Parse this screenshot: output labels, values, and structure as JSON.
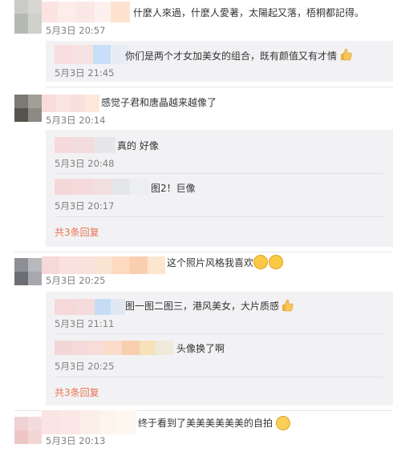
{
  "comments": [
    {
      "text": "什麼人來過，什麼人愛著，太陽起又落，梧桐都記得。",
      "time": "5月3日 20:57",
      "replies": [
        {
          "text": "你们是两个才女加美女的组合，既有颜值又有才情",
          "time": "5月3日 21:45",
          "icon": "thumbs-up-icon"
        }
      ]
    },
    {
      "text": "感觉子君和唐晶越来越像了",
      "time": "5月3日 20:14",
      "replies": [
        {
          "text": "真的 好像",
          "time": "5月3日 20:48"
        },
        {
          "text": "图2！巨像",
          "time": "5月3日 20:17"
        }
      ],
      "more_link": "共3条回复"
    },
    {
      "text": "这个照片风格我喜欢",
      "time": "5月3日 20:25",
      "icon": "laughing-emoji-icon",
      "replies": [
        {
          "text": "图一图二图三，港风美女，大片质感",
          "time": "5月3日 21:11",
          "icon": "thumbs-up-icon"
        },
        {
          "text": "头像换了啊",
          "time": "5月3日 20:25"
        }
      ],
      "more_link": "共3条回复"
    },
    {
      "text": "终于看到了美美美美美美的自拍",
      "time": "5月3日 20:13",
      "icon": "peace-sign-icon"
    }
  ]
}
